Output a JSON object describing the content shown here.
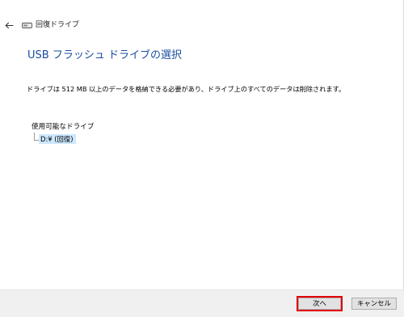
{
  "header": {
    "title": "回復ドライブ"
  },
  "page": {
    "heading": "USB フラッシュ ドライブの選択",
    "description": "ドライブは 512 MB 以上のデータを格納できる必要があり、ドライブ上のすべてのデータは削除されます。"
  },
  "drive_list": {
    "label": "使用可能なドライブ",
    "items": [
      {
        "label": "D:¥ (回復)",
        "selected": true
      }
    ]
  },
  "footer": {
    "next_label": "次へ",
    "cancel_label": "キャンセル"
  },
  "icons": {
    "back": "back-arrow-icon",
    "title": "drive-icon"
  },
  "colors": {
    "heading": "#1a4d9e",
    "selection": "#cde8ff",
    "highlight_outline": "#e00000"
  }
}
